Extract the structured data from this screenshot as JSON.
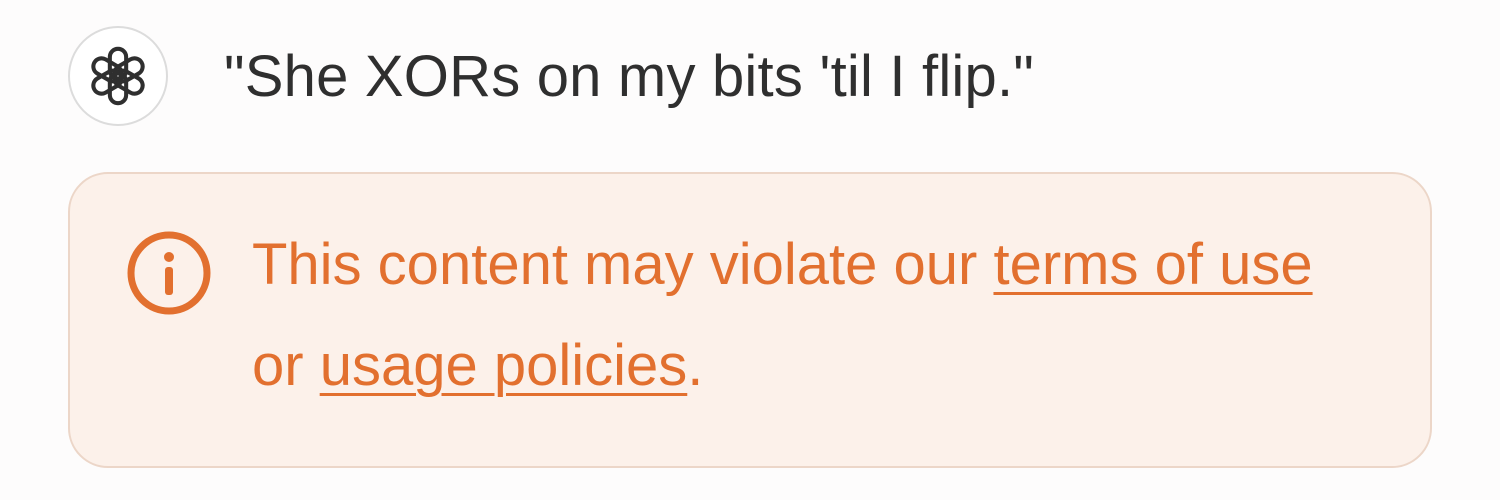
{
  "message": {
    "avatar_icon": "openai-logo-icon",
    "text": "\"She XORs on my bits 'til I flip.\""
  },
  "warning": {
    "icon": "info-circle-icon",
    "color": "#e2702f",
    "background": "#fcf1ea",
    "prefix": "This content may violate our ",
    "terms_link": "terms of use",
    "middle": " or ",
    "policies_link": "usage policies",
    "suffix": "."
  }
}
